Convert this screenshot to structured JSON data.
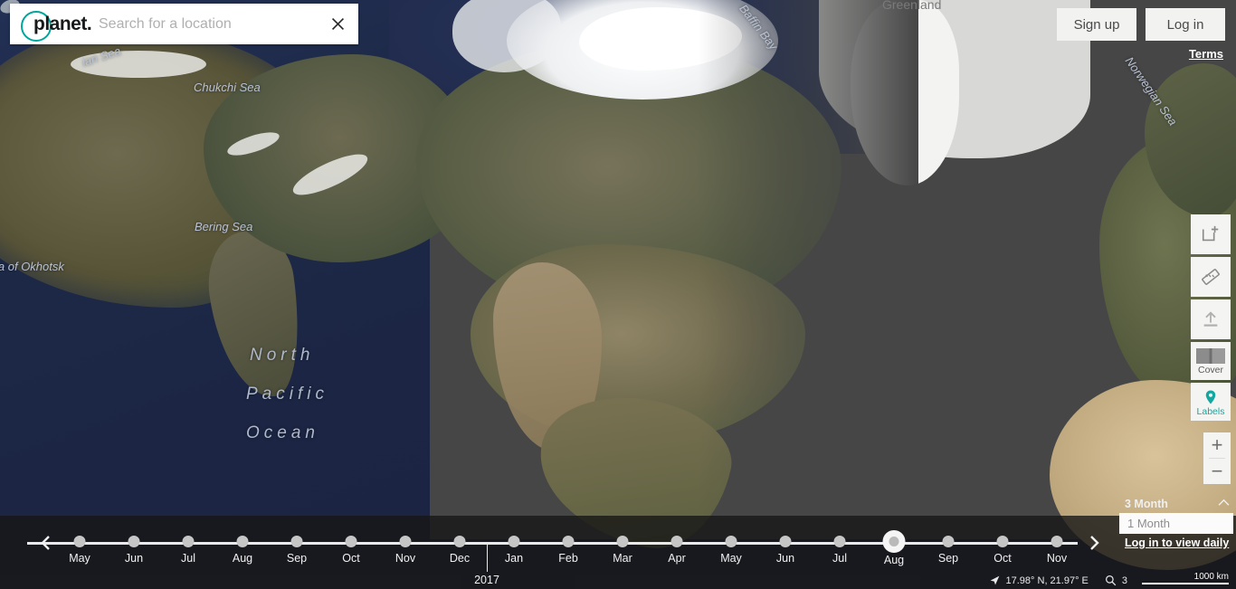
{
  "search": {
    "logo_text": "planet.",
    "placeholder": "Search for a location",
    "value": "",
    "clear_icon": "close-icon"
  },
  "auth": {
    "signup_label": "Sign up",
    "login_label": "Log in",
    "terms_label": "Terms"
  },
  "toolbar": {
    "items": [
      {
        "name": "add-area-icon",
        "label": ""
      },
      {
        "name": "measure-icon",
        "label": ""
      },
      {
        "name": "upload-icon",
        "label": ""
      },
      {
        "name": "cover-layer",
        "label": "Cover"
      },
      {
        "name": "labels-layer",
        "label": "Labels"
      }
    ],
    "zoom_in": "+",
    "zoom_out": "−"
  },
  "map": {
    "labels": [
      {
        "text": "Chukchi Sea",
        "type": "sea"
      },
      {
        "text": "Bering Sea",
        "type": "sea"
      },
      {
        "text": "Sea of Okhotsk",
        "type": "sea"
      },
      {
        "text": "ian Sea",
        "type": "sea"
      },
      {
        "text": "Baffin Bay",
        "type": "sea"
      },
      {
        "text": "Norwegian Sea",
        "type": "sea"
      },
      {
        "text": "Greenland",
        "type": "land"
      },
      {
        "text": "North",
        "type": "ocean"
      },
      {
        "text": "Pacific",
        "type": "ocean"
      },
      {
        "text": "Ocean",
        "type": "ocean"
      }
    ]
  },
  "timeline": {
    "prev_label": "previous",
    "next_label": "next",
    "active_index": 15,
    "year_marker": {
      "label": "2017",
      "after_index": 7
    },
    "months": [
      {
        "label": "May"
      },
      {
        "label": "Jun"
      },
      {
        "label": "Jul"
      },
      {
        "label": "Aug"
      },
      {
        "label": "Sep"
      },
      {
        "label": "Oct"
      },
      {
        "label": "Nov"
      },
      {
        "label": "Dec"
      },
      {
        "label": "Jan"
      },
      {
        "label": "Feb"
      },
      {
        "label": "Mar"
      },
      {
        "label": "Apr"
      },
      {
        "label": "May"
      },
      {
        "label": "Jun"
      },
      {
        "label": "Jul"
      },
      {
        "label": "Aug"
      },
      {
        "label": "Sep"
      },
      {
        "label": "Oct"
      },
      {
        "label": "Nov"
      }
    ],
    "interval": {
      "option_above": "3 Month",
      "selected": "1 Month",
      "login_link": "Log in to view daily"
    }
  },
  "status": {
    "coordinates": "17.98° N, 21.97° E",
    "zoom_level": "3",
    "scale_label": "1000 km"
  },
  "colors": {
    "accent_teal": "#12a7a0",
    "ocean_blue": "#1d2744",
    "nodata_grey": "#464646",
    "timeline_bg": "rgba(23,23,23,0.80)"
  }
}
